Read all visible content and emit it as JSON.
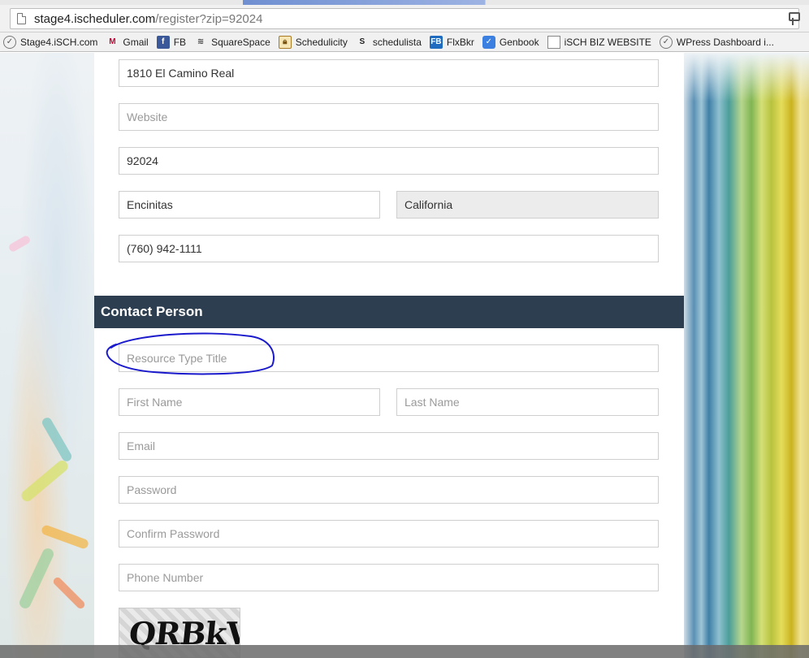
{
  "browser": {
    "url_host": "stage4.ischeduler.com",
    "url_path": "/register?zip=92024",
    "bookmarks": [
      {
        "label": "Stage4.iSCH.com",
        "icon": "check-circle-icon"
      },
      {
        "label": "Gmail",
        "icon": "gmail-icon"
      },
      {
        "label": "FB",
        "icon": "facebook-icon"
      },
      {
        "label": "SquareSpace",
        "icon": "squarespace-icon"
      },
      {
        "label": "Schedulicity",
        "icon": "lock-icon"
      },
      {
        "label": "schedulista",
        "icon": "schedulista-icon"
      },
      {
        "label": "FlxBkr",
        "icon": "flexbooker-icon"
      },
      {
        "label": "Genbook",
        "icon": "genbook-icon"
      },
      {
        "label": "iSCH BIZ WEBSITE",
        "icon": "document-icon"
      },
      {
        "label": "WPress Dashboard i...",
        "icon": "wordpress-icon"
      }
    ]
  },
  "business": {
    "address": "1810 El Camino Real",
    "website_placeholder": "Website",
    "zip": "92024",
    "city": "Encinitas",
    "state": "California",
    "phone": "(760) 942-1111"
  },
  "contact": {
    "title": "Contact Person",
    "resource_type_placeholder": "Resource Type Title",
    "first_name_placeholder": "First Name",
    "last_name_placeholder": "Last Name",
    "email_placeholder": "Email",
    "password_placeholder": "Password",
    "confirm_password_placeholder": "Confirm Password",
    "phone_placeholder": "Phone Number"
  },
  "captcha": {
    "text": "QRBkV"
  },
  "colors": {
    "section_bar": "#2c3e50",
    "annotation": "#1a1acc"
  }
}
